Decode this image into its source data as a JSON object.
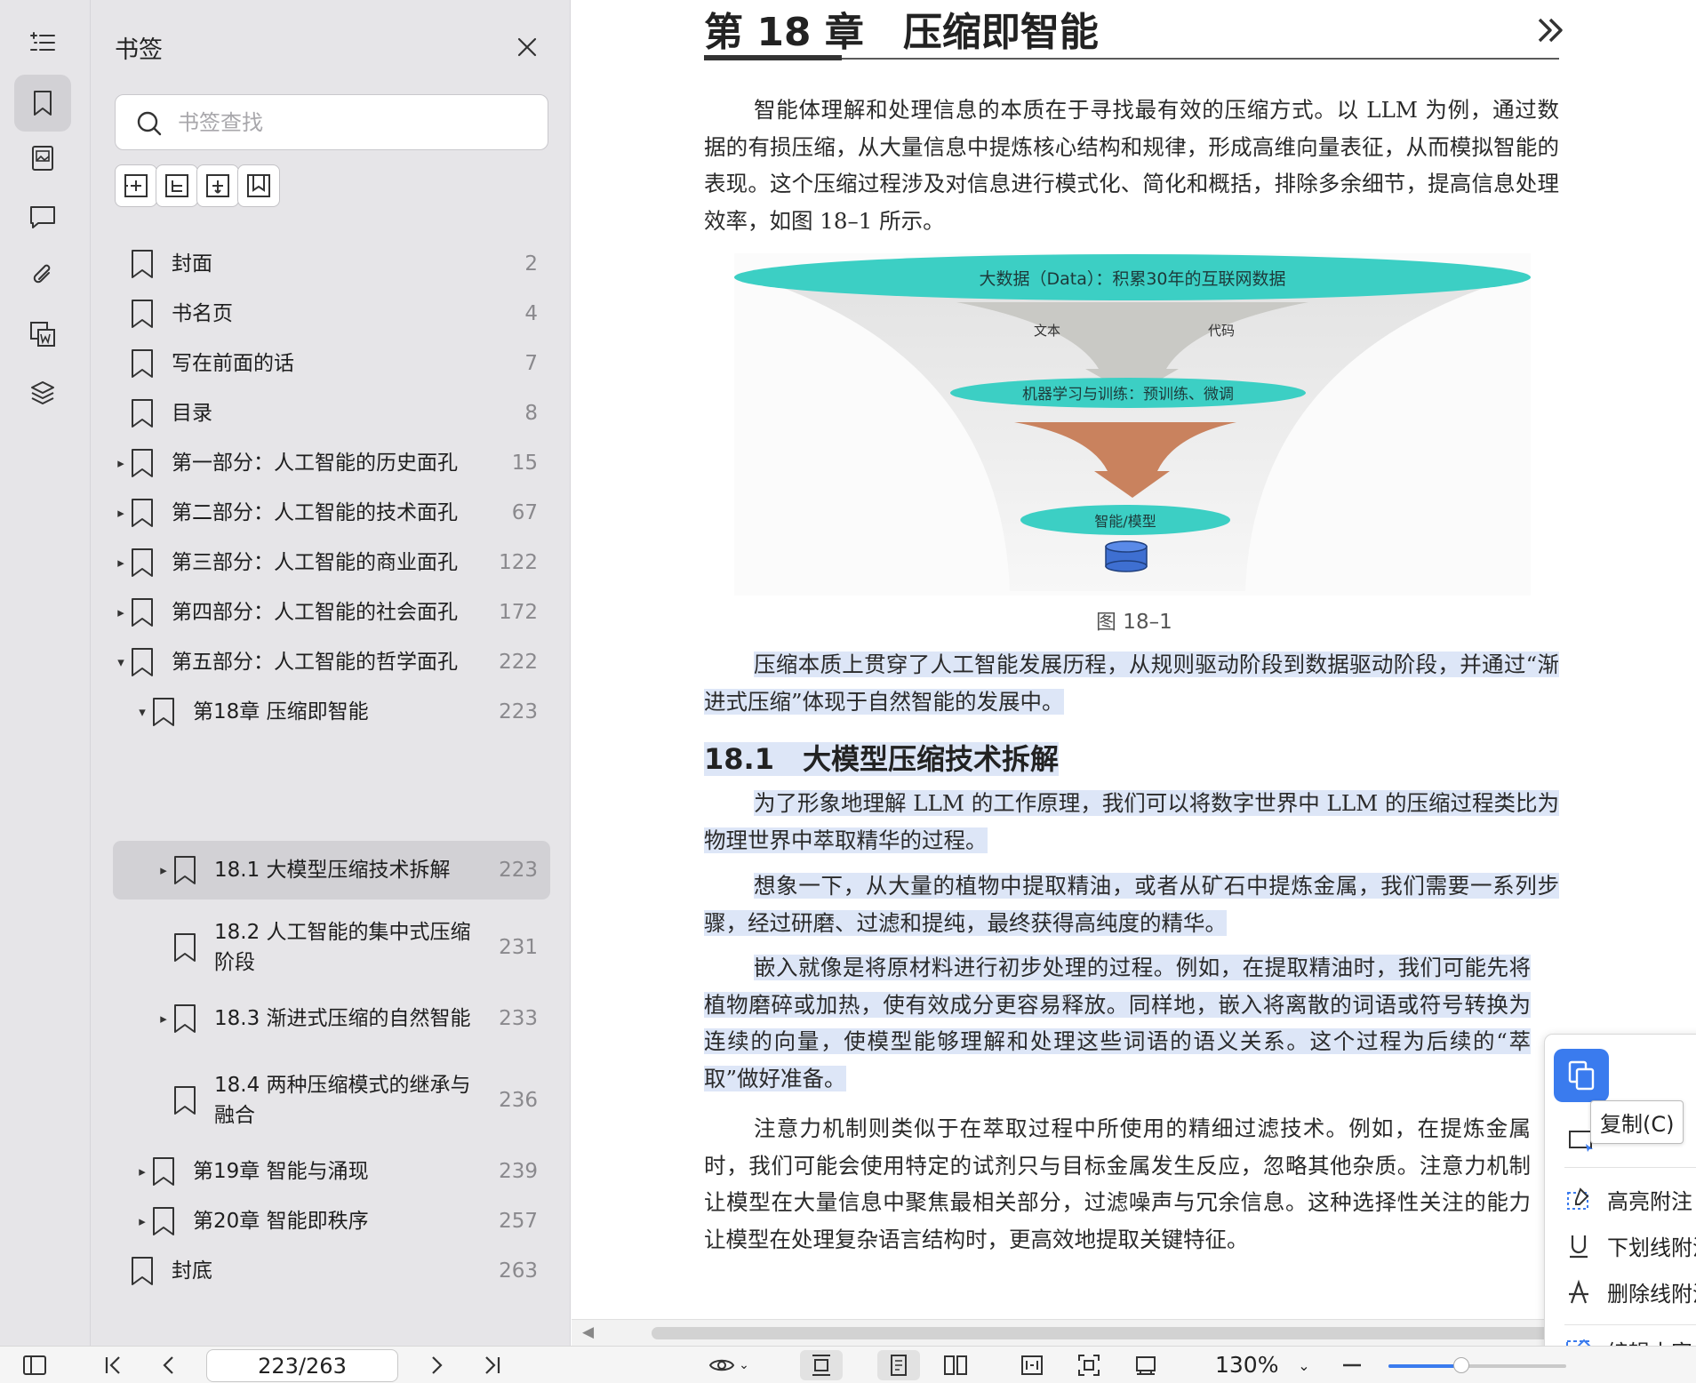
{
  "rail": {
    "items": [
      {
        "name": "outline-icon"
      },
      {
        "name": "bookmark-icon"
      },
      {
        "name": "thumbnail-icon"
      },
      {
        "name": "comment-icon"
      },
      {
        "name": "attachment-icon"
      },
      {
        "name": "word-convert-icon"
      },
      {
        "name": "layers-icon"
      }
    ]
  },
  "panel": {
    "title": "书签",
    "search_placeholder": "书签查找",
    "bookmarks": [
      {
        "label": "封面",
        "page": "2",
        "caret": ""
      },
      {
        "label": "书名页",
        "page": "4",
        "caret": ""
      },
      {
        "label": "写在前面的话",
        "page": "7",
        "caret": ""
      },
      {
        "label": "目录",
        "page": "8",
        "caret": ""
      },
      {
        "label": "第一部分：人工智能的历史面孔",
        "page": "15",
        "caret": "▸"
      },
      {
        "label": "第二部分：人工智能的技术面孔",
        "page": "67",
        "caret": "▸"
      },
      {
        "label": "第三部分：人工智能的商业面孔",
        "page": "122",
        "caret": "▸"
      },
      {
        "label": "第四部分：人工智能的社会面孔",
        "page": "172",
        "caret": "▸"
      },
      {
        "label": "第五部分：人工智能的哲学面孔",
        "page": "222",
        "caret": "▾"
      },
      {
        "label": "第18章 压缩即智能",
        "page": "223",
        "caret": "▾"
      },
      {
        "label": "18.1 大模型压缩技术拆解",
        "page": "223",
        "caret": "▸"
      },
      {
        "label": "18.2 人工智能的集中式压缩阶段",
        "page": "231",
        "caret": ""
      },
      {
        "label": "18.3 渐进式压缩的自然智能",
        "page": "233",
        "caret": "▸"
      },
      {
        "label": "18.4 两种压缩模式的继承与融合",
        "page": "236",
        "caret": ""
      },
      {
        "label": "第19章 智能与涌现",
        "page": "239",
        "caret": "▸"
      },
      {
        "label": "第20章 智能即秩序",
        "page": "257",
        "caret": "▸"
      },
      {
        "label": "封底",
        "page": "263",
        "caret": ""
      }
    ]
  },
  "document": {
    "chapter_title": "第 18 章　压缩即智能",
    "paragraphs": [
      "智能体理解和处理信息的本质在于寻找最有效的压缩方式。以 LLM 为例，通过数据的有损压缩，从大量信息中提炼核心结构和规律，形成高维向量表征，从而模拟智能的表现。这个压缩过程涉及对信息进行模式化、简化和概括，排除多余细节，提高信息处理效率，如图 18–1 所示。",
      "压缩本质上贯穿了人工智能发展历程，从规则驱动阶段到数据驱动阶段，并通过“渐进式压缩”体现于自然智能的发展中。",
      "为了形象地理解 LLM 的工作原理，我们可以将数字世界中 LLM 的压缩过程类比为物理世界中萃取精华的过程。",
      "想象一下，从大量的植物中提取精油，或者从矿石中提炼金属，我们需要一系列步骤，经过研磨、过滤和提纯，最终获得高纯度的精华。",
      "嵌入就像是将原材料进行初步处理的过程。例如，在提取精油时，我们可能先将植物磨碎或加热，使有效成分更容易释放。同样地，嵌入将离散的词语或符号转换为连续的向量，使模型能够理解和处理这些词语的语义关系。这个过程为后续的“萃取”做好准备。",
      "注意力机制则类似于在萃取过程中所使用的精细过滤技术。例如，在提炼金属时，我们可能会使用特定的试剂只与目标金属发生反应，忽略其他杂质。注意力机制让模型在大量信息中聚焦最相关部分，过滤噪声与冗余信息。这种选择性关注的能力让模型在处理复杂语言结构时，更高效地提取关键特征。"
    ],
    "section_title": "18.1　大模型压缩技术拆解",
    "figure": {
      "top_label": "大数据（Data）：积累30年的互联网数据",
      "left_label": "文本",
      "right_label": "代码",
      "mid_label": "机器学习与训练：预训练、微调",
      "bottom_label": "智能/模型",
      "caption": "图 18–1"
    }
  },
  "context_menu": {
    "copy_tooltip": "复制(C)",
    "items": [
      "高亮附注",
      "下划线附注",
      "删除线附注",
      "编辑内容"
    ]
  },
  "bottombar": {
    "page_indicator": "223/263",
    "zoom": "130%",
    "zoom_level": 0.41
  },
  "colors": {
    "accent": "#3a7bee",
    "highlight": "#dde6f7",
    "figure_teal": "#3ccfc4",
    "figure_orange": "#c9825e",
    "figure_cylinder": "#3e6fd1"
  }
}
